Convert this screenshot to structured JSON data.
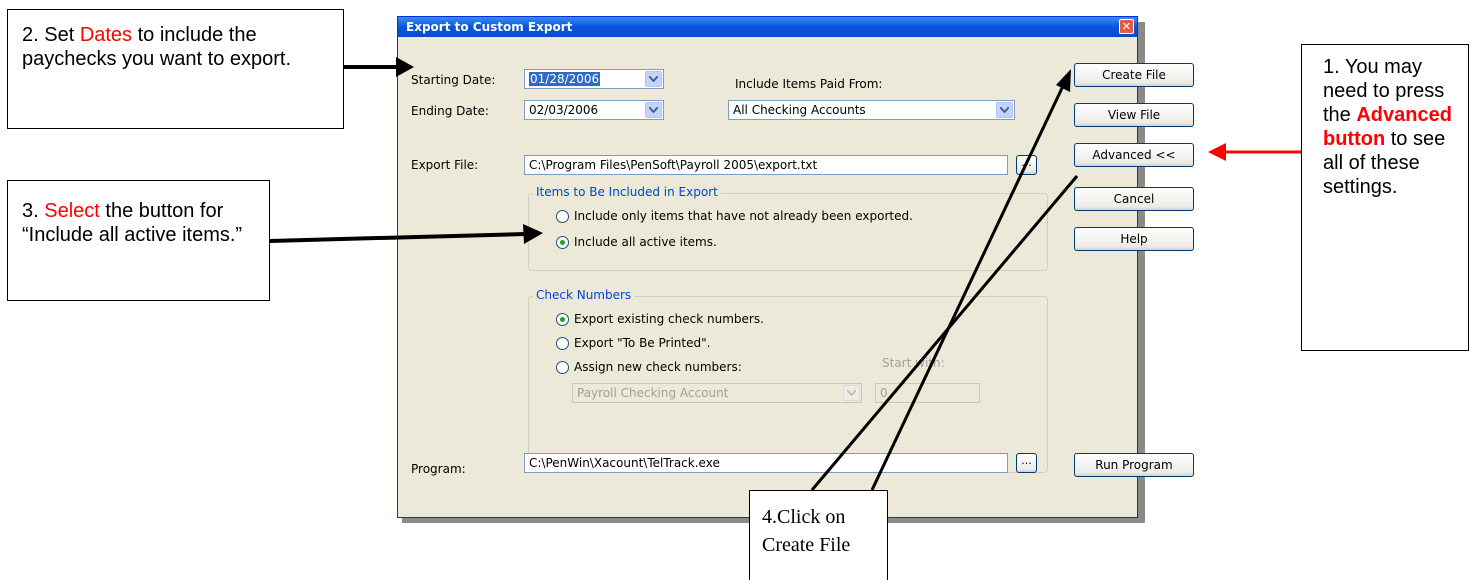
{
  "dialog": {
    "title": "Export to Custom Export",
    "starting_date_label": "Starting Date:",
    "starting_date_value": "01/28/2006",
    "ending_date_label": "Ending Date:",
    "ending_date_value": "02/03/2006",
    "include_paid_from_label": "Include Items Paid From:",
    "include_paid_from_value": "All Checking Accounts",
    "export_file_label": "Export File:",
    "export_file_value": "C:\\Program Files\\PenSoft\\Payroll 2005\\export.txt",
    "browse_label": "...",
    "items_group_title": "Items to Be Included in Export",
    "items_option_1": "Include only items that have not already been exported.",
    "items_option_2": "Include all active items.",
    "check_group_title": "Check Numbers",
    "check_option_1": "Export existing check numbers.",
    "check_option_2": "Export \"To Be Printed\".",
    "check_option_3": "Assign new check numbers:",
    "start_with_label": "Start with:",
    "account_value": "Payroll Checking Account",
    "start_with_value": "0",
    "program_label": "Program:",
    "program_value": "C:\\PenWin\\Xacount\\TelTrack.exe",
    "buttons": {
      "create_file": "Create File",
      "view_file": "View File",
      "advanced": "Advanced <<",
      "cancel": "Cancel",
      "help": "Help",
      "run_program": "Run Program"
    }
  },
  "callouts": {
    "step1": {
      "prefix": "1. You may need to press the ",
      "highlight": "Advanced button",
      "suffix": " to see all of these settings."
    },
    "step2": {
      "prefix": "2. Set ",
      "highlight": "Dates",
      "suffix": " to include the paychecks you want to export."
    },
    "step3": {
      "prefix": "3. ",
      "highlight": "Select",
      "suffix": " the button for “Include all active items.”"
    },
    "step4": {
      "line1": "4.Click on",
      "line2": "Create File"
    }
  },
  "colors": {
    "highlight_red": "#ff0000",
    "titlebar_blue": "#0a4ccc",
    "dialog_bg": "#ece9d8",
    "radio_selected": "#21a121"
  },
  "icons": [
    "close-icon",
    "dropdown-arrow-icon",
    "radio-icon",
    "arrow-icon"
  ]
}
